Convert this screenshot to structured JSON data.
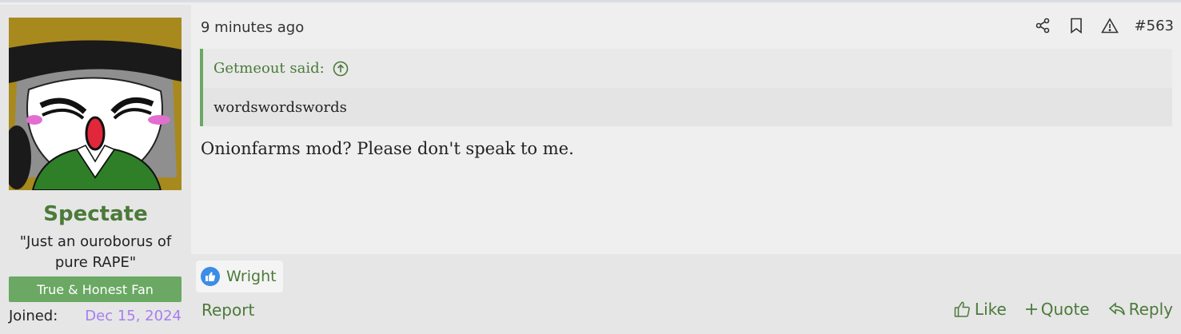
{
  "user": {
    "username": "Spectate",
    "title": "\"Just an ouroborus of pure RAPE\"",
    "banner": "True & Honest Fan",
    "joined_label": "Joined:",
    "joined_value": "Dec 15, 2024"
  },
  "post": {
    "time": "9 minutes ago",
    "number": "#563",
    "quote": {
      "author": "Getmeout said:",
      "text": "wordswordswords"
    },
    "message": "Onionfarms mod? Please don't speak to me.",
    "reaction": {
      "icon": "thumbs-up-icon",
      "reactor": "Wright"
    },
    "report_label": "Report",
    "actions": {
      "like": "Like",
      "quote": "Quote",
      "reply": "Reply"
    }
  },
  "colors": {
    "accent_green": "#4b7a3a",
    "banner_green": "#6aa863",
    "joined_purple": "#a77ef0",
    "reaction_blue": "#3b8de6"
  }
}
